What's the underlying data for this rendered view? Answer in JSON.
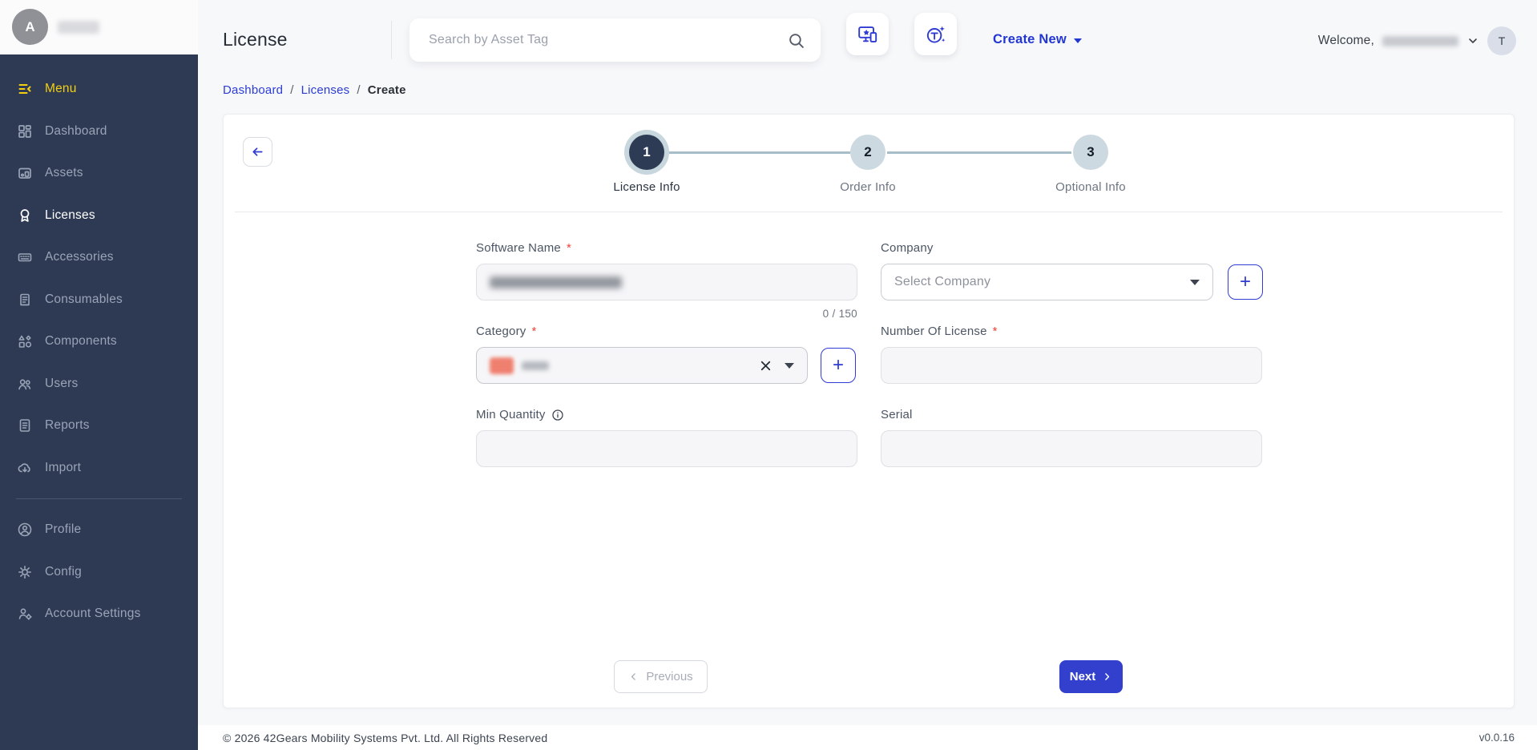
{
  "colors": {
    "sidebar_bg": "#2e3a54",
    "accent_blue": "#2f3bd3",
    "menu_highlight_yellow": "#f2cf13",
    "step_active_navy": "#2e3b55",
    "step_inactive": "#ccd9e0",
    "next_button_bg": "#3340cd",
    "category_chip": "#ef7f6e",
    "required_red": "#f0413a"
  },
  "sidebar": {
    "workspace_initial": "A",
    "items": [
      {
        "label": "Menu",
        "icon": "menu-collapse-icon"
      },
      {
        "label": "Dashboard",
        "icon": "dashboard-icon"
      },
      {
        "label": "Assets",
        "icon": "assets-icon"
      },
      {
        "label": "Licenses",
        "icon": "licenses-icon",
        "active": true
      },
      {
        "label": "Accessories",
        "icon": "accessories-icon"
      },
      {
        "label": "Consumables",
        "icon": "consumables-icon"
      },
      {
        "label": "Components",
        "icon": "components-icon"
      },
      {
        "label": "Users",
        "icon": "users-icon"
      },
      {
        "label": "Reports",
        "icon": "reports-icon"
      },
      {
        "label": "Import",
        "icon": "import-icon"
      }
    ],
    "secondary_items": [
      {
        "label": "Profile",
        "icon": "profile-icon"
      },
      {
        "label": "Config",
        "icon": "config-gear-icon"
      },
      {
        "label": "Account Settings",
        "icon": "account-settings-icon"
      }
    ]
  },
  "topbar": {
    "page_title": "License",
    "search_placeholder": "Search by Asset Tag",
    "search_icon": "magnifier",
    "action_buttons": [
      {
        "icon": "device-star-icon"
      },
      {
        "icon": "tag-sparkle-icon"
      }
    ],
    "create_new_label": "Create New",
    "welcome_label": "Welcome,",
    "user_initial": "T"
  },
  "breadcrumb": {
    "separator": "/",
    "links": [
      "Dashboard",
      "Licenses"
    ],
    "current": "Create"
  },
  "stepper": {
    "steps": [
      {
        "number": "1",
        "label": "License Info",
        "state": "active"
      },
      {
        "number": "2",
        "label": "Order Info",
        "state": "upcoming"
      },
      {
        "number": "3",
        "label": "Optional Info",
        "state": "upcoming"
      }
    ]
  },
  "form": {
    "required_marker": "*",
    "software_name": {
      "label": "Software Name",
      "required": true,
      "value_redacted": true,
      "counter": "0 / 150"
    },
    "company": {
      "label": "Company",
      "placeholder": "Select Company"
    },
    "category": {
      "label": "Category",
      "required": true,
      "selected_chip_redacted": true
    },
    "number_of_license": {
      "label": "Number Of License",
      "required": true,
      "value": ""
    },
    "min_quantity": {
      "label": "Min Quantity",
      "info_icon": "info-circle",
      "value": ""
    },
    "serial": {
      "label": "Serial",
      "value": ""
    }
  },
  "actions": {
    "previous_label": "Previous",
    "next_label": "Next"
  },
  "footer": {
    "copyright": "© 2026 42Gears Mobility Systems Pvt. Ltd. All Rights Reserved",
    "version": "v0.0.16"
  }
}
